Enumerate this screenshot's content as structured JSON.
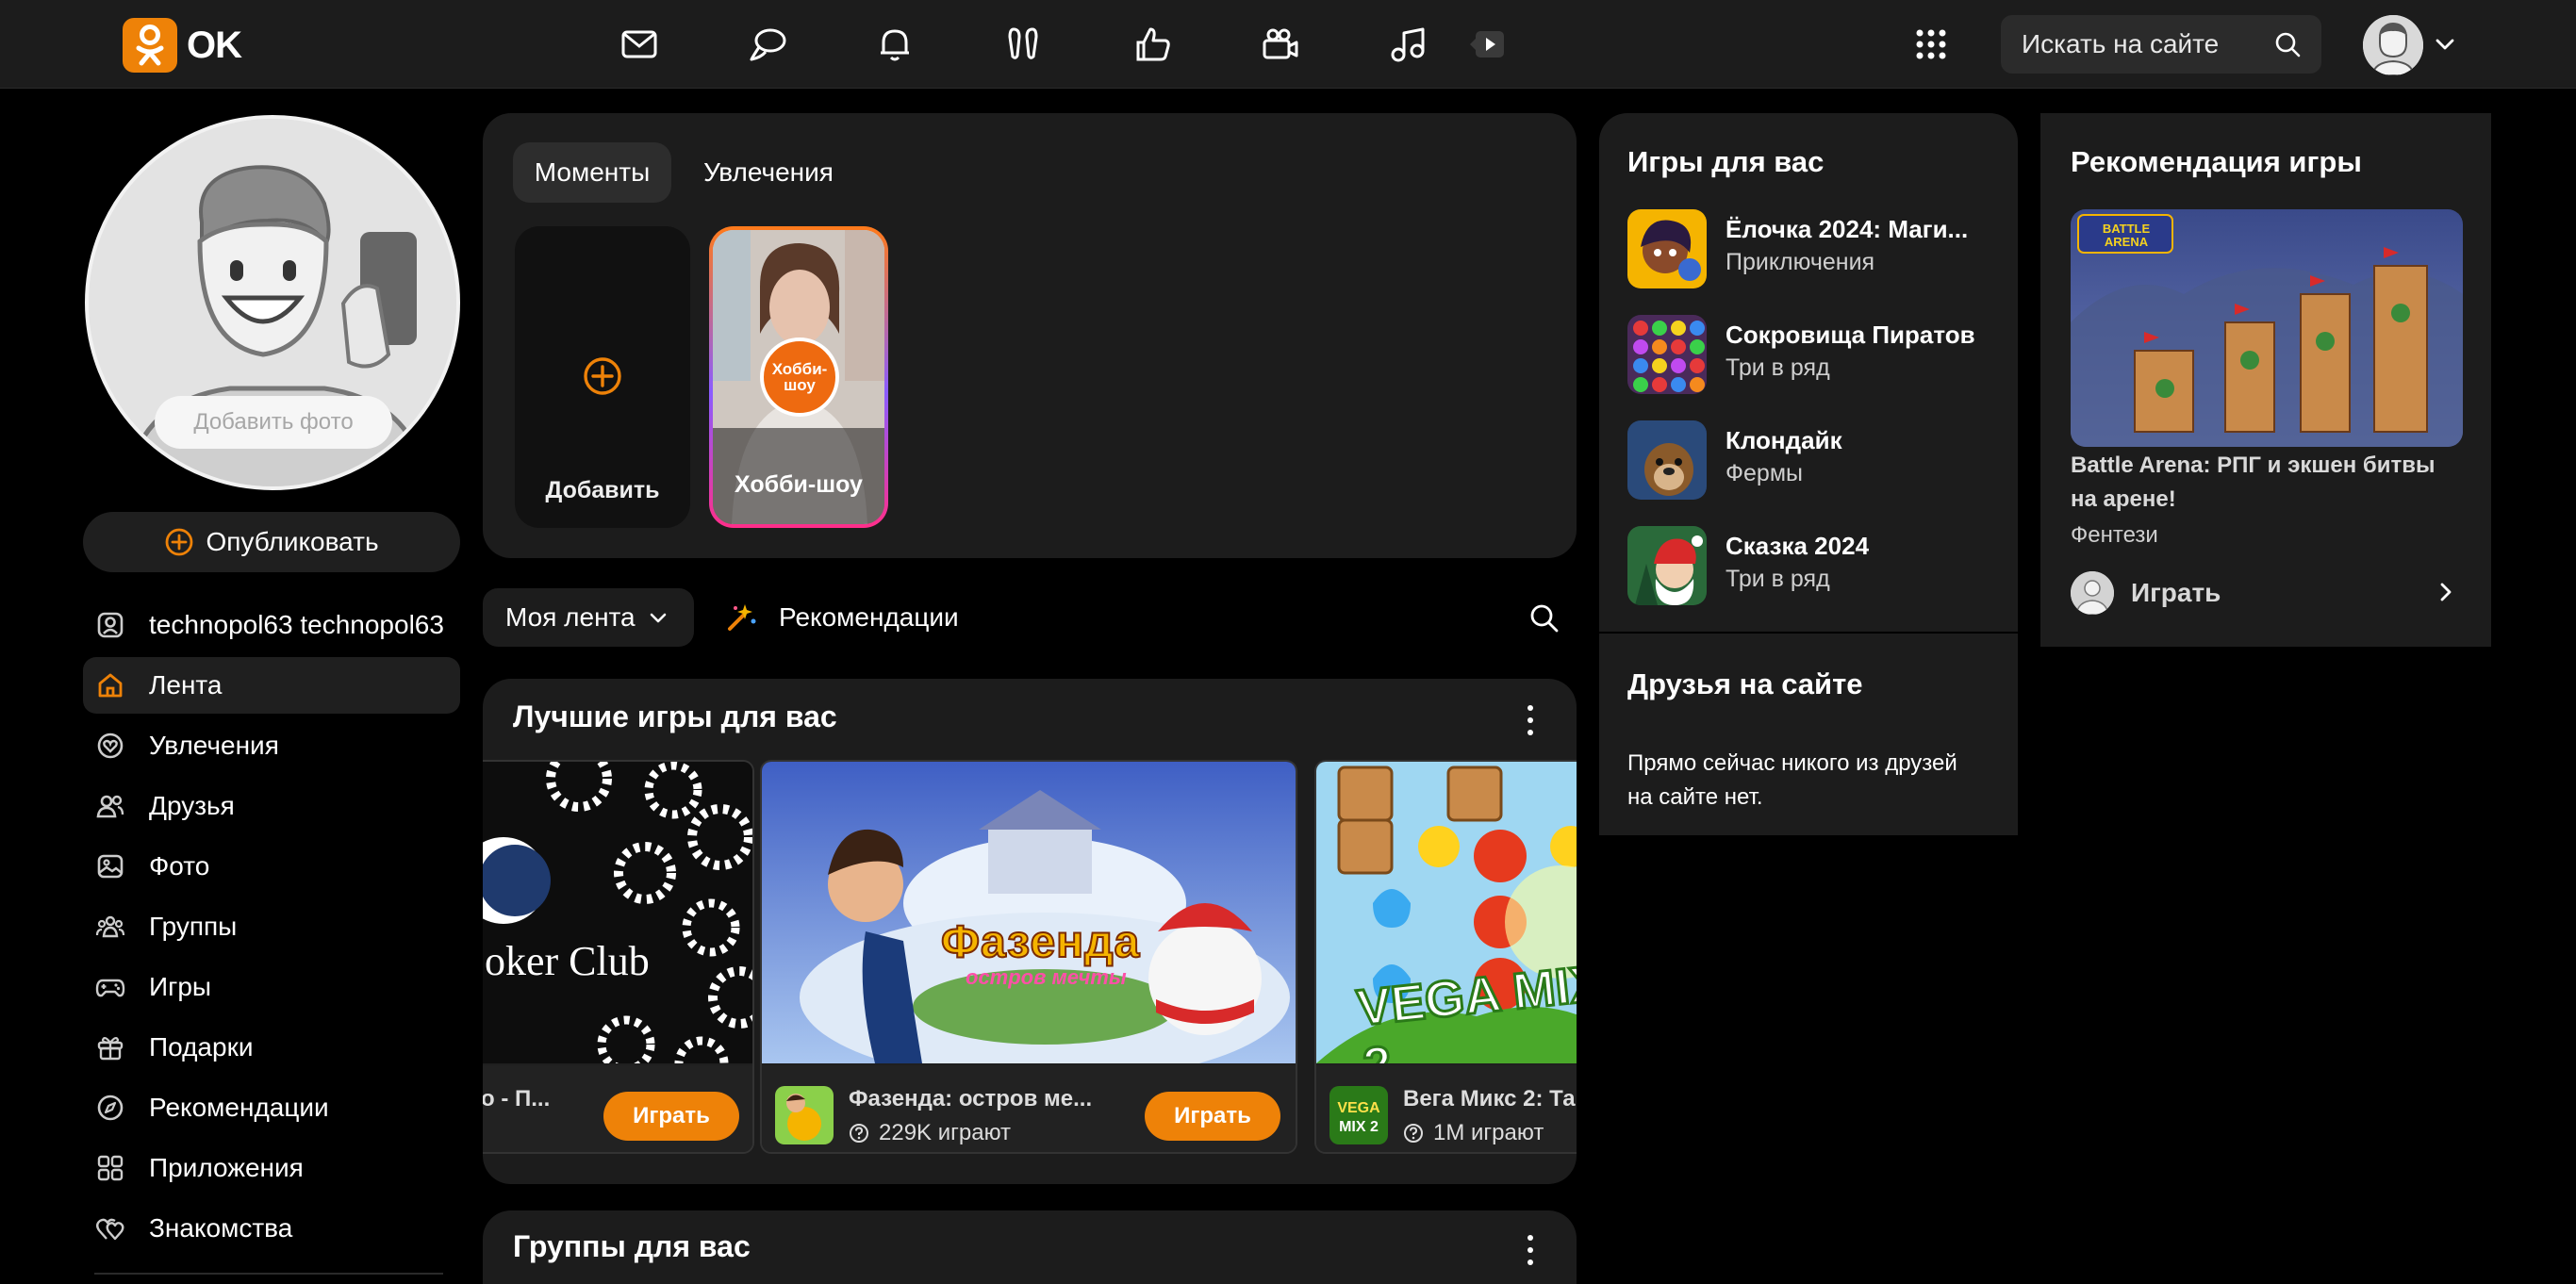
{
  "header": {
    "logo_text": "OK",
    "search_placeholder": "Искать на сайте",
    "nav_icons": [
      "messages-icon",
      "discussions-icon",
      "notifications-icon",
      "guests-icon",
      "reactions-icon",
      "video-icon",
      "music-icon",
      "video-play-icon"
    ]
  },
  "profile": {
    "add_photo_label": "Добавить фото",
    "publish_label": "Опубликовать"
  },
  "sidebar": {
    "items": [
      {
        "label": "technopol63 technopol63",
        "icon": "user-icon"
      },
      {
        "label": "Лента",
        "icon": "home-icon",
        "active": true
      },
      {
        "label": "Увлечения",
        "icon": "hobbies-icon"
      },
      {
        "label": "Друзья",
        "icon": "friends-icon"
      },
      {
        "label": "Фото",
        "icon": "photo-icon"
      },
      {
        "label": "Группы",
        "icon": "groups-icon"
      },
      {
        "label": "Игры",
        "icon": "gamepad-icon"
      },
      {
        "label": "Подарки",
        "icon": "gift-icon"
      },
      {
        "label": "Рекомендации",
        "icon": "compass-icon"
      },
      {
        "label": "Приложения",
        "icon": "apps-icon"
      },
      {
        "label": "Знакомства",
        "icon": "dating-icon"
      }
    ]
  },
  "moments": {
    "tabs": [
      "Моменты",
      "Увлечения"
    ],
    "add_label": "Добавить",
    "story_label": "Хобби-шоу",
    "story_badge": "Хобби-шоу"
  },
  "feed": {
    "selector_label": "Моя лента",
    "recommendations_label": "Рекомендации"
  },
  "best_games": {
    "title": "Лучшие игры для вас",
    "tiles": [
      {
        "name": "о - П...",
        "image_text": "oker Club",
        "play_label": "Играть"
      },
      {
        "name": "Фазенда: остров ме...",
        "count": "229K играют",
        "image_text": "Фазенда",
        "image_subtext": "остров мечты",
        "play_label": "Играть"
      },
      {
        "name": "Вега Микс 2: Та",
        "count": "1M играют",
        "image_text": "VEGA MIX 2"
      }
    ]
  },
  "groups_section": {
    "title": "Группы для вас"
  },
  "games_for_you": {
    "title": "Игры для вас",
    "items": [
      {
        "title": "Ёлочка 2024: Маги...",
        "genre": "Приключения"
      },
      {
        "title": "Сокровища Пиратов",
        "genre": "Три в ряд"
      },
      {
        "title": "Клондайк",
        "genre": "Фермы"
      },
      {
        "title": "Сказка 2024",
        "genre": "Три в ряд"
      }
    ]
  },
  "friends_online": {
    "title": "Друзья на сайте",
    "text": "Прямо сейчас никого из друзей на сайте нет."
  },
  "game_recommendation": {
    "title": "Рекомендация игры",
    "game_title": "Battle Arena: РПГ и экшен битвы на арене!",
    "genre": "Фентези",
    "play_label": "Играть",
    "image_text": "BATTLE ARENA"
  },
  "colors": {
    "accent": "#ee8208",
    "background": "#000000",
    "card": "#1c1c1c"
  }
}
